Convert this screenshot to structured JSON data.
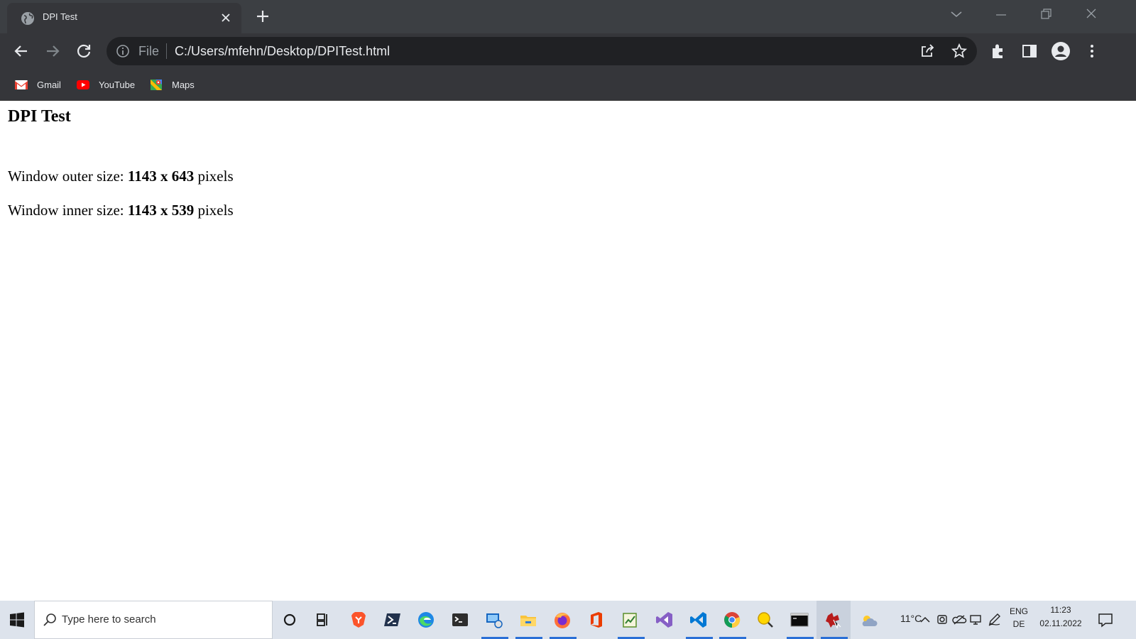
{
  "browser": {
    "tab": {
      "title": "DPI Test"
    },
    "omnibox": {
      "scheme": "File",
      "url": "C:/Users/mfehn/Desktop/DPITest.html"
    },
    "bookmarks": [
      {
        "label": "Gmail",
        "icon": "gmail-icon"
      },
      {
        "label": "YouTube",
        "icon": "youtube-icon"
      },
      {
        "label": "Maps",
        "icon": "maps-icon"
      }
    ]
  },
  "page": {
    "heading": "DPI Test",
    "outer": {
      "prefix": "Window outer size: ",
      "value": "1143 x 643",
      "suffix": " pixels"
    },
    "inner": {
      "prefix": "Window inner size: ",
      "value": "1143 x 539",
      "suffix": " pixels"
    }
  },
  "taskbar": {
    "search_placeholder": "Type here to search",
    "weather": {
      "temp": "11°C"
    },
    "language": {
      "line1": "ENG",
      "line2": "DE"
    },
    "clock": {
      "time": "11:23",
      "date": "02.11.2022"
    }
  },
  "colors": {
    "chrome_dark": "#35363a",
    "tabstrip": "#3c3f43",
    "omnibox": "#202124",
    "taskbar": "#dde3ec",
    "taskbar_active_underline": "#2a6fd6"
  }
}
